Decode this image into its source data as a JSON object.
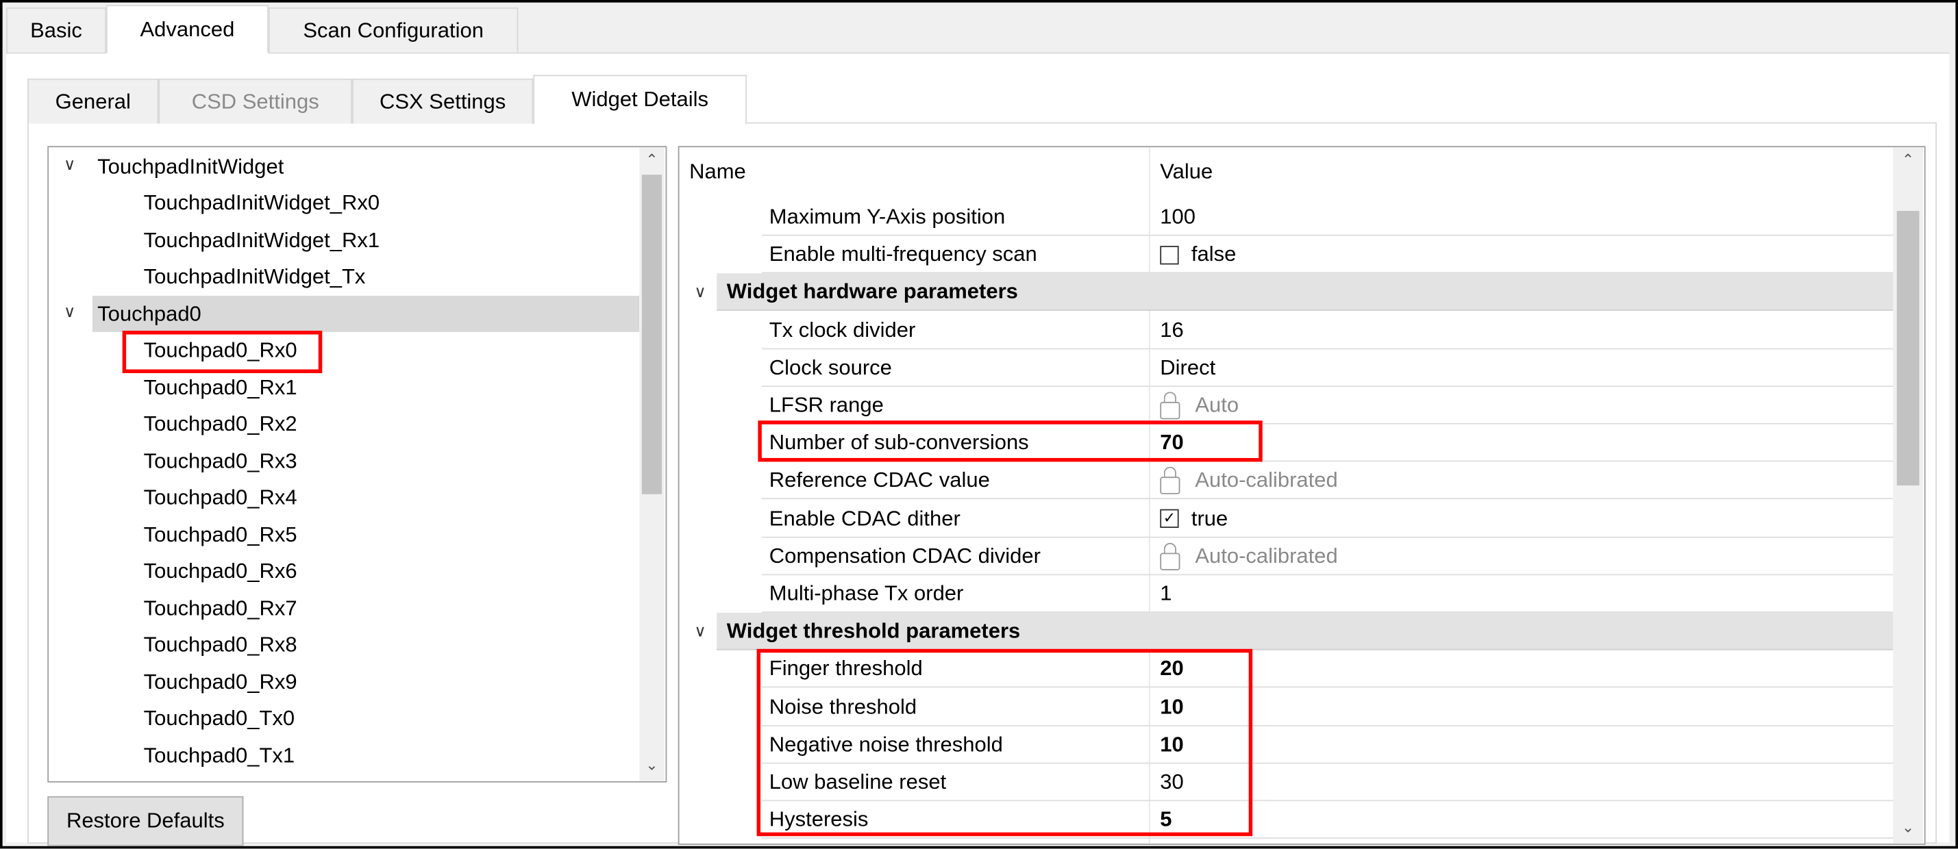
{
  "top_tabs": [
    {
      "label": "Basic"
    },
    {
      "label": "Advanced",
      "selected": true
    },
    {
      "label": "Scan Configuration"
    }
  ],
  "sub_tabs": [
    {
      "label": "General"
    },
    {
      "label": "CSD Settings",
      "disabled": true
    },
    {
      "label": "CSX Settings"
    },
    {
      "label": "Widget Details",
      "selected": true
    }
  ],
  "tree": {
    "items": [
      {
        "label": "TouchpadInitWidget",
        "level": 0,
        "expanded": true
      },
      {
        "label": "TouchpadInitWidget_Rx0",
        "level": 1
      },
      {
        "label": "TouchpadInitWidget_Rx1",
        "level": 1
      },
      {
        "label": "TouchpadInitWidget_Tx",
        "level": 1
      },
      {
        "label": "Touchpad0",
        "level": 0,
        "expanded": true,
        "selected": true
      },
      {
        "label": "Touchpad0_Rx0",
        "level": 1,
        "highlighted": true
      },
      {
        "label": "Touchpad0_Rx1",
        "level": 1
      },
      {
        "label": "Touchpad0_Rx2",
        "level": 1
      },
      {
        "label": "Touchpad0_Rx3",
        "level": 1
      },
      {
        "label": "Touchpad0_Rx4",
        "level": 1
      },
      {
        "label": "Touchpad0_Rx5",
        "level": 1
      },
      {
        "label": "Touchpad0_Rx6",
        "level": 1
      },
      {
        "label": "Touchpad0_Rx7",
        "level": 1
      },
      {
        "label": "Touchpad0_Rx8",
        "level": 1
      },
      {
        "label": "Touchpad0_Rx9",
        "level": 1
      },
      {
        "label": "Touchpad0_Tx0",
        "level": 1
      },
      {
        "label": "Touchpad0_Tx1",
        "level": 1
      }
    ]
  },
  "restore_defaults": "Restore Defaults",
  "grid": {
    "headers": {
      "name": "Name",
      "value": "Value"
    },
    "rows": [
      {
        "name": "Maximum Y-Axis position",
        "value": "100"
      },
      {
        "name": "Enable multi-frequency scan",
        "value": "false",
        "checkbox": false
      },
      {
        "name": "Widget hardware parameters",
        "group": true
      },
      {
        "name": "Tx clock divider",
        "value": "16"
      },
      {
        "name": "Clock source",
        "value": "Direct"
      },
      {
        "name": "LFSR range",
        "value": "Auto",
        "locked": true
      },
      {
        "name": "Number of sub-conversions",
        "value": "70",
        "bold": true
      },
      {
        "name": "Reference CDAC value",
        "value": "Auto-calibrated",
        "locked": true
      },
      {
        "name": "Enable CDAC dither",
        "value": "true",
        "checkbox": true
      },
      {
        "name": "Compensation CDAC divider",
        "value": "Auto-calibrated",
        "locked": true
      },
      {
        "name": "Multi-phase Tx order",
        "value": "1"
      },
      {
        "name": "Widget threshold parameters",
        "group": true
      },
      {
        "name": "Finger threshold",
        "value": "20",
        "bold": true
      },
      {
        "name": "Noise threshold",
        "value": "10",
        "bold": true
      },
      {
        "name": "Negative noise threshold",
        "value": "10",
        "bold": true
      },
      {
        "name": "Low baseline reset",
        "value": "30"
      },
      {
        "name": "Hysteresis",
        "value": "5",
        "bold": true
      }
    ]
  },
  "colors": {
    "highlight": "#ff0000",
    "group_bg": "#e3e3e3",
    "selected_bg": "#d9d9d9"
  }
}
